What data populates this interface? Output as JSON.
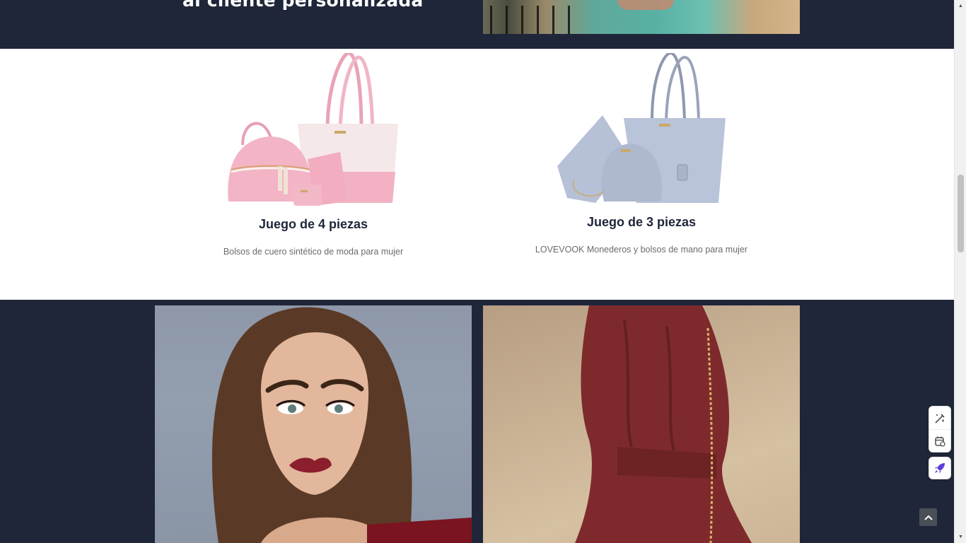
{
  "hero": {
    "heading": "al cliente personalizada"
  },
  "products": [
    {
      "title": "Juego de 4 piezas",
      "description": "Bolsos de cuero sintético de moda para mujer",
      "color": "#f2b8c6"
    },
    {
      "title": "Juego de 3 piezas",
      "description": "LOVEVOOK Monederos y bolsos de mano para mujer",
      "color": "#b9c3d9"
    }
  ],
  "colors": {
    "dark_band": "#1f263a",
    "title": "#1f263a",
    "description": "#6b6b6b",
    "accent": "#5b3fd8"
  },
  "icons": {
    "tool_1": "edit-ai-icon",
    "tool_2": "calendar-icon",
    "rocket": "rocket-icon",
    "back_to_top": "chevron-up-icon"
  }
}
